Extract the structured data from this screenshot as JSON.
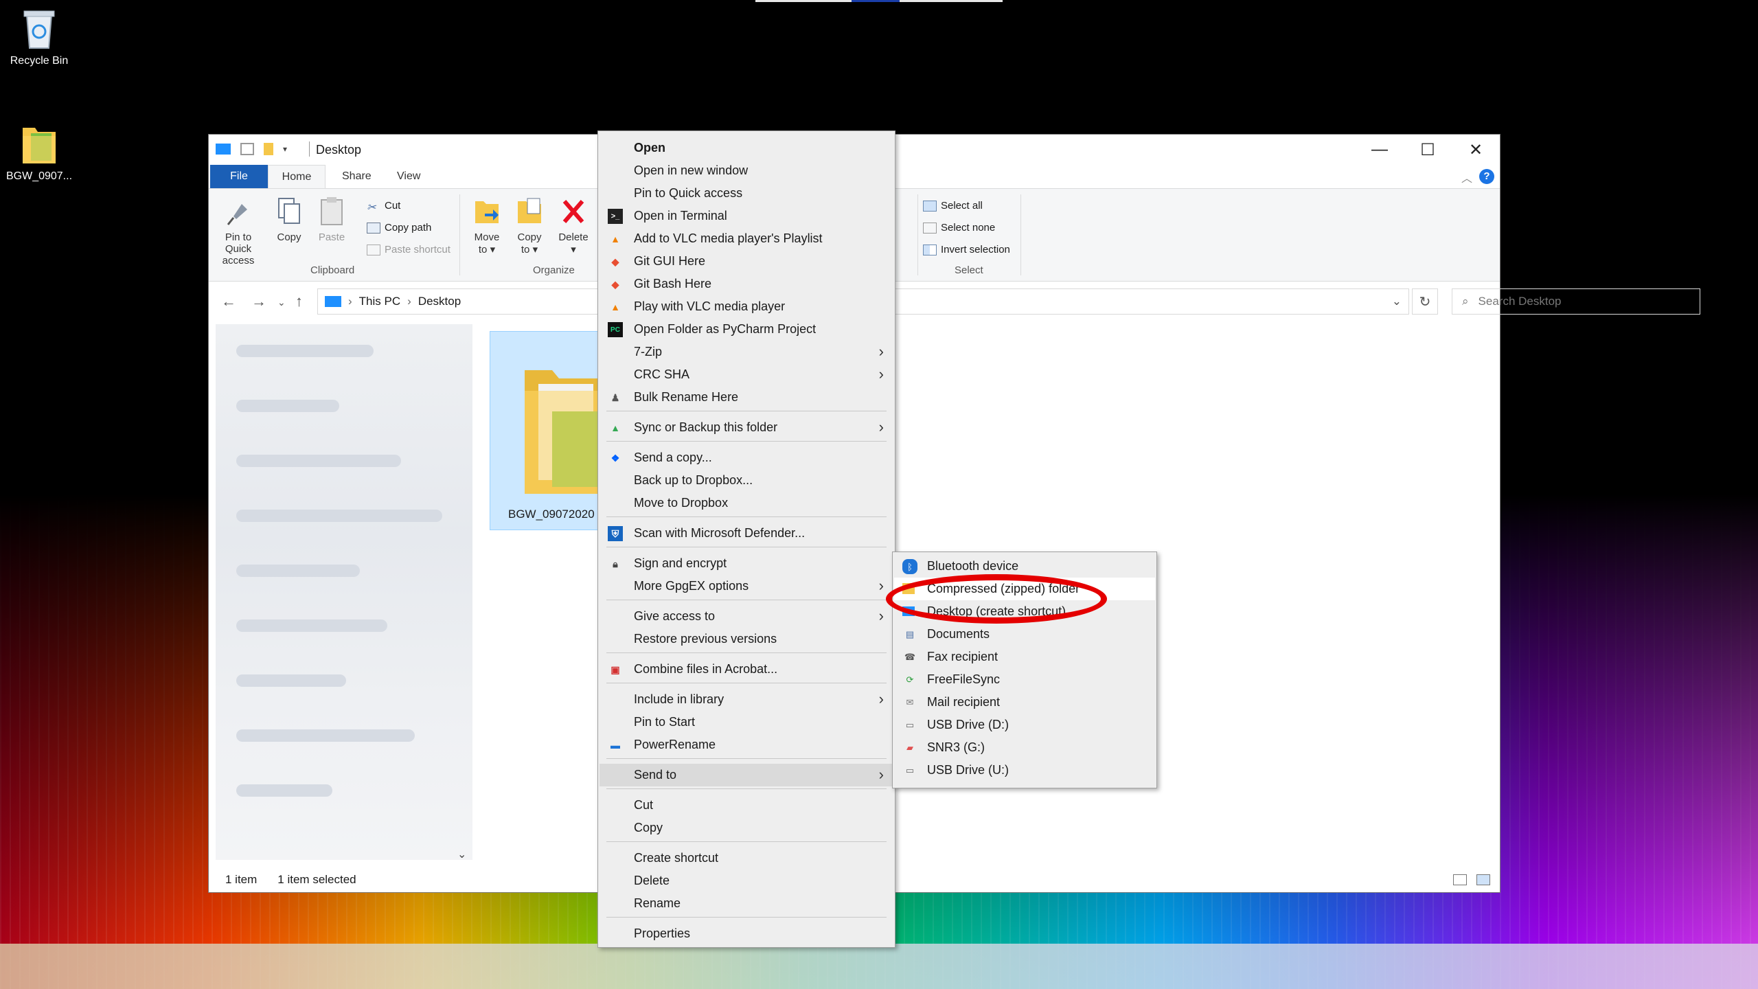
{
  "desktop": {
    "icons": [
      {
        "label": "Recycle Bin"
      },
      {
        "label": "BGW_0907..."
      }
    ]
  },
  "explorer": {
    "title": "Desktop",
    "window_controls": {
      "minimize": "—",
      "maximize": "☐",
      "close": "✕"
    },
    "tabs": [
      "File",
      "Home",
      "Share",
      "View"
    ],
    "ribbon": {
      "pin_label_1": "Pin to Quick",
      "pin_label_2": "access",
      "copy_label": "Copy",
      "paste_label": "Paste",
      "cut_label": "Cut",
      "copy_path_label": "Copy path",
      "paste_shortcut_label": "Paste shortcut",
      "clipboard_group": "Clipboard",
      "move_label_1": "Move",
      "move_label_2": "to",
      "copyto_label_1": "Copy",
      "copyto_label_2": "to",
      "delete_label": "Delete",
      "organize_group": "Organize",
      "select_all": "Select all",
      "select_none": "Select none",
      "invert_selection": "Invert selection",
      "select_group": "Select"
    },
    "address": {
      "crumb_1": "This PC",
      "crumb_2": "Desktop",
      "search_placeholder": "Search Desktop"
    },
    "file": {
      "name": "BGW_09072020"
    },
    "status": {
      "count": "1 item",
      "selected": "1 item selected"
    }
  },
  "context_menu": {
    "items": [
      "Open",
      "Open in new window",
      "Pin to Quick access",
      "Open in Terminal",
      "Add to VLC media player's Playlist",
      "Git GUI Here",
      "Git Bash Here",
      "Play with VLC media player",
      "Open Folder as PyCharm Project",
      "7-Zip",
      "CRC SHA",
      "Bulk Rename Here",
      "Sync or Backup this folder",
      "Send a copy...",
      "Back up to Dropbox...",
      "Move to Dropbox",
      "Scan with Microsoft Defender...",
      "Sign and encrypt",
      "More GpgEX options",
      "Give access to",
      "Restore previous versions",
      "Combine files in Acrobat...",
      "Include in library",
      "Pin to Start",
      "PowerRename",
      "Send to",
      "Cut",
      "Copy",
      "Create shortcut",
      "Delete",
      "Rename",
      "Properties"
    ]
  },
  "send_to_menu": {
    "items": [
      "Bluetooth device",
      "Compressed (zipped) folder",
      "Desktop (create shortcut)",
      "Documents",
      "Fax recipient",
      "FreeFileSync",
      "Mail recipient",
      "USB Drive (D:)",
      "SNR3 (G:)",
      "USB Drive (U:)"
    ],
    "highlighted": "Compressed (zipped) folder",
    "annotation_color": "#e40000"
  }
}
